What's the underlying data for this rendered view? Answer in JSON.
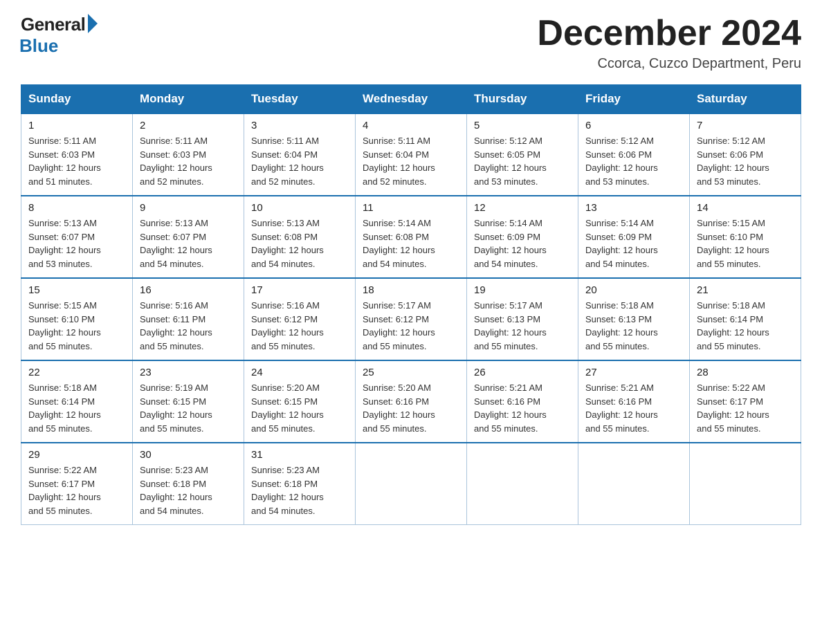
{
  "header": {
    "logo_general": "General",
    "logo_blue": "Blue",
    "month_year": "December 2024",
    "location": "Ccorca, Cuzco Department, Peru"
  },
  "columns": [
    "Sunday",
    "Monday",
    "Tuesday",
    "Wednesday",
    "Thursday",
    "Friday",
    "Saturday"
  ],
  "weeks": [
    [
      {
        "day": "1",
        "sunrise": "5:11 AM",
        "sunset": "6:03 PM",
        "daylight": "12 hours and 51 minutes."
      },
      {
        "day": "2",
        "sunrise": "5:11 AM",
        "sunset": "6:03 PM",
        "daylight": "12 hours and 52 minutes."
      },
      {
        "day": "3",
        "sunrise": "5:11 AM",
        "sunset": "6:04 PM",
        "daylight": "12 hours and 52 minutes."
      },
      {
        "day": "4",
        "sunrise": "5:11 AM",
        "sunset": "6:04 PM",
        "daylight": "12 hours and 52 minutes."
      },
      {
        "day": "5",
        "sunrise": "5:12 AM",
        "sunset": "6:05 PM",
        "daylight": "12 hours and 53 minutes."
      },
      {
        "day": "6",
        "sunrise": "5:12 AM",
        "sunset": "6:06 PM",
        "daylight": "12 hours and 53 minutes."
      },
      {
        "day": "7",
        "sunrise": "5:12 AM",
        "sunset": "6:06 PM",
        "daylight": "12 hours and 53 minutes."
      }
    ],
    [
      {
        "day": "8",
        "sunrise": "5:13 AM",
        "sunset": "6:07 PM",
        "daylight": "12 hours and 53 minutes."
      },
      {
        "day": "9",
        "sunrise": "5:13 AM",
        "sunset": "6:07 PM",
        "daylight": "12 hours and 54 minutes."
      },
      {
        "day": "10",
        "sunrise": "5:13 AM",
        "sunset": "6:08 PM",
        "daylight": "12 hours and 54 minutes."
      },
      {
        "day": "11",
        "sunrise": "5:14 AM",
        "sunset": "6:08 PM",
        "daylight": "12 hours and 54 minutes."
      },
      {
        "day": "12",
        "sunrise": "5:14 AM",
        "sunset": "6:09 PM",
        "daylight": "12 hours and 54 minutes."
      },
      {
        "day": "13",
        "sunrise": "5:14 AM",
        "sunset": "6:09 PM",
        "daylight": "12 hours and 54 minutes."
      },
      {
        "day": "14",
        "sunrise": "5:15 AM",
        "sunset": "6:10 PM",
        "daylight": "12 hours and 55 minutes."
      }
    ],
    [
      {
        "day": "15",
        "sunrise": "5:15 AM",
        "sunset": "6:10 PM",
        "daylight": "12 hours and 55 minutes."
      },
      {
        "day": "16",
        "sunrise": "5:16 AM",
        "sunset": "6:11 PM",
        "daylight": "12 hours and 55 minutes."
      },
      {
        "day": "17",
        "sunrise": "5:16 AM",
        "sunset": "6:12 PM",
        "daylight": "12 hours and 55 minutes."
      },
      {
        "day": "18",
        "sunrise": "5:17 AM",
        "sunset": "6:12 PM",
        "daylight": "12 hours and 55 minutes."
      },
      {
        "day": "19",
        "sunrise": "5:17 AM",
        "sunset": "6:13 PM",
        "daylight": "12 hours and 55 minutes."
      },
      {
        "day": "20",
        "sunrise": "5:18 AM",
        "sunset": "6:13 PM",
        "daylight": "12 hours and 55 minutes."
      },
      {
        "day": "21",
        "sunrise": "5:18 AM",
        "sunset": "6:14 PM",
        "daylight": "12 hours and 55 minutes."
      }
    ],
    [
      {
        "day": "22",
        "sunrise": "5:18 AM",
        "sunset": "6:14 PM",
        "daylight": "12 hours and 55 minutes."
      },
      {
        "day": "23",
        "sunrise": "5:19 AM",
        "sunset": "6:15 PM",
        "daylight": "12 hours and 55 minutes."
      },
      {
        "day": "24",
        "sunrise": "5:20 AM",
        "sunset": "6:15 PM",
        "daylight": "12 hours and 55 minutes."
      },
      {
        "day": "25",
        "sunrise": "5:20 AM",
        "sunset": "6:16 PM",
        "daylight": "12 hours and 55 minutes."
      },
      {
        "day": "26",
        "sunrise": "5:21 AM",
        "sunset": "6:16 PM",
        "daylight": "12 hours and 55 minutes."
      },
      {
        "day": "27",
        "sunrise": "5:21 AM",
        "sunset": "6:16 PM",
        "daylight": "12 hours and 55 minutes."
      },
      {
        "day": "28",
        "sunrise": "5:22 AM",
        "sunset": "6:17 PM",
        "daylight": "12 hours and 55 minutes."
      }
    ],
    [
      {
        "day": "29",
        "sunrise": "5:22 AM",
        "sunset": "6:17 PM",
        "daylight": "12 hours and 55 minutes."
      },
      {
        "day": "30",
        "sunrise": "5:23 AM",
        "sunset": "6:18 PM",
        "daylight": "12 hours and 54 minutes."
      },
      {
        "day": "31",
        "sunrise": "5:23 AM",
        "sunset": "6:18 PM",
        "daylight": "12 hours and 54 minutes."
      },
      null,
      null,
      null,
      null
    ]
  ],
  "labels": {
    "sunrise": "Sunrise:",
    "sunset": "Sunset:",
    "daylight": "Daylight:"
  },
  "colors": {
    "header_bg": "#1a6faf",
    "header_text": "#ffffff",
    "border": "#aac4db",
    "week_border": "#1a6faf"
  }
}
